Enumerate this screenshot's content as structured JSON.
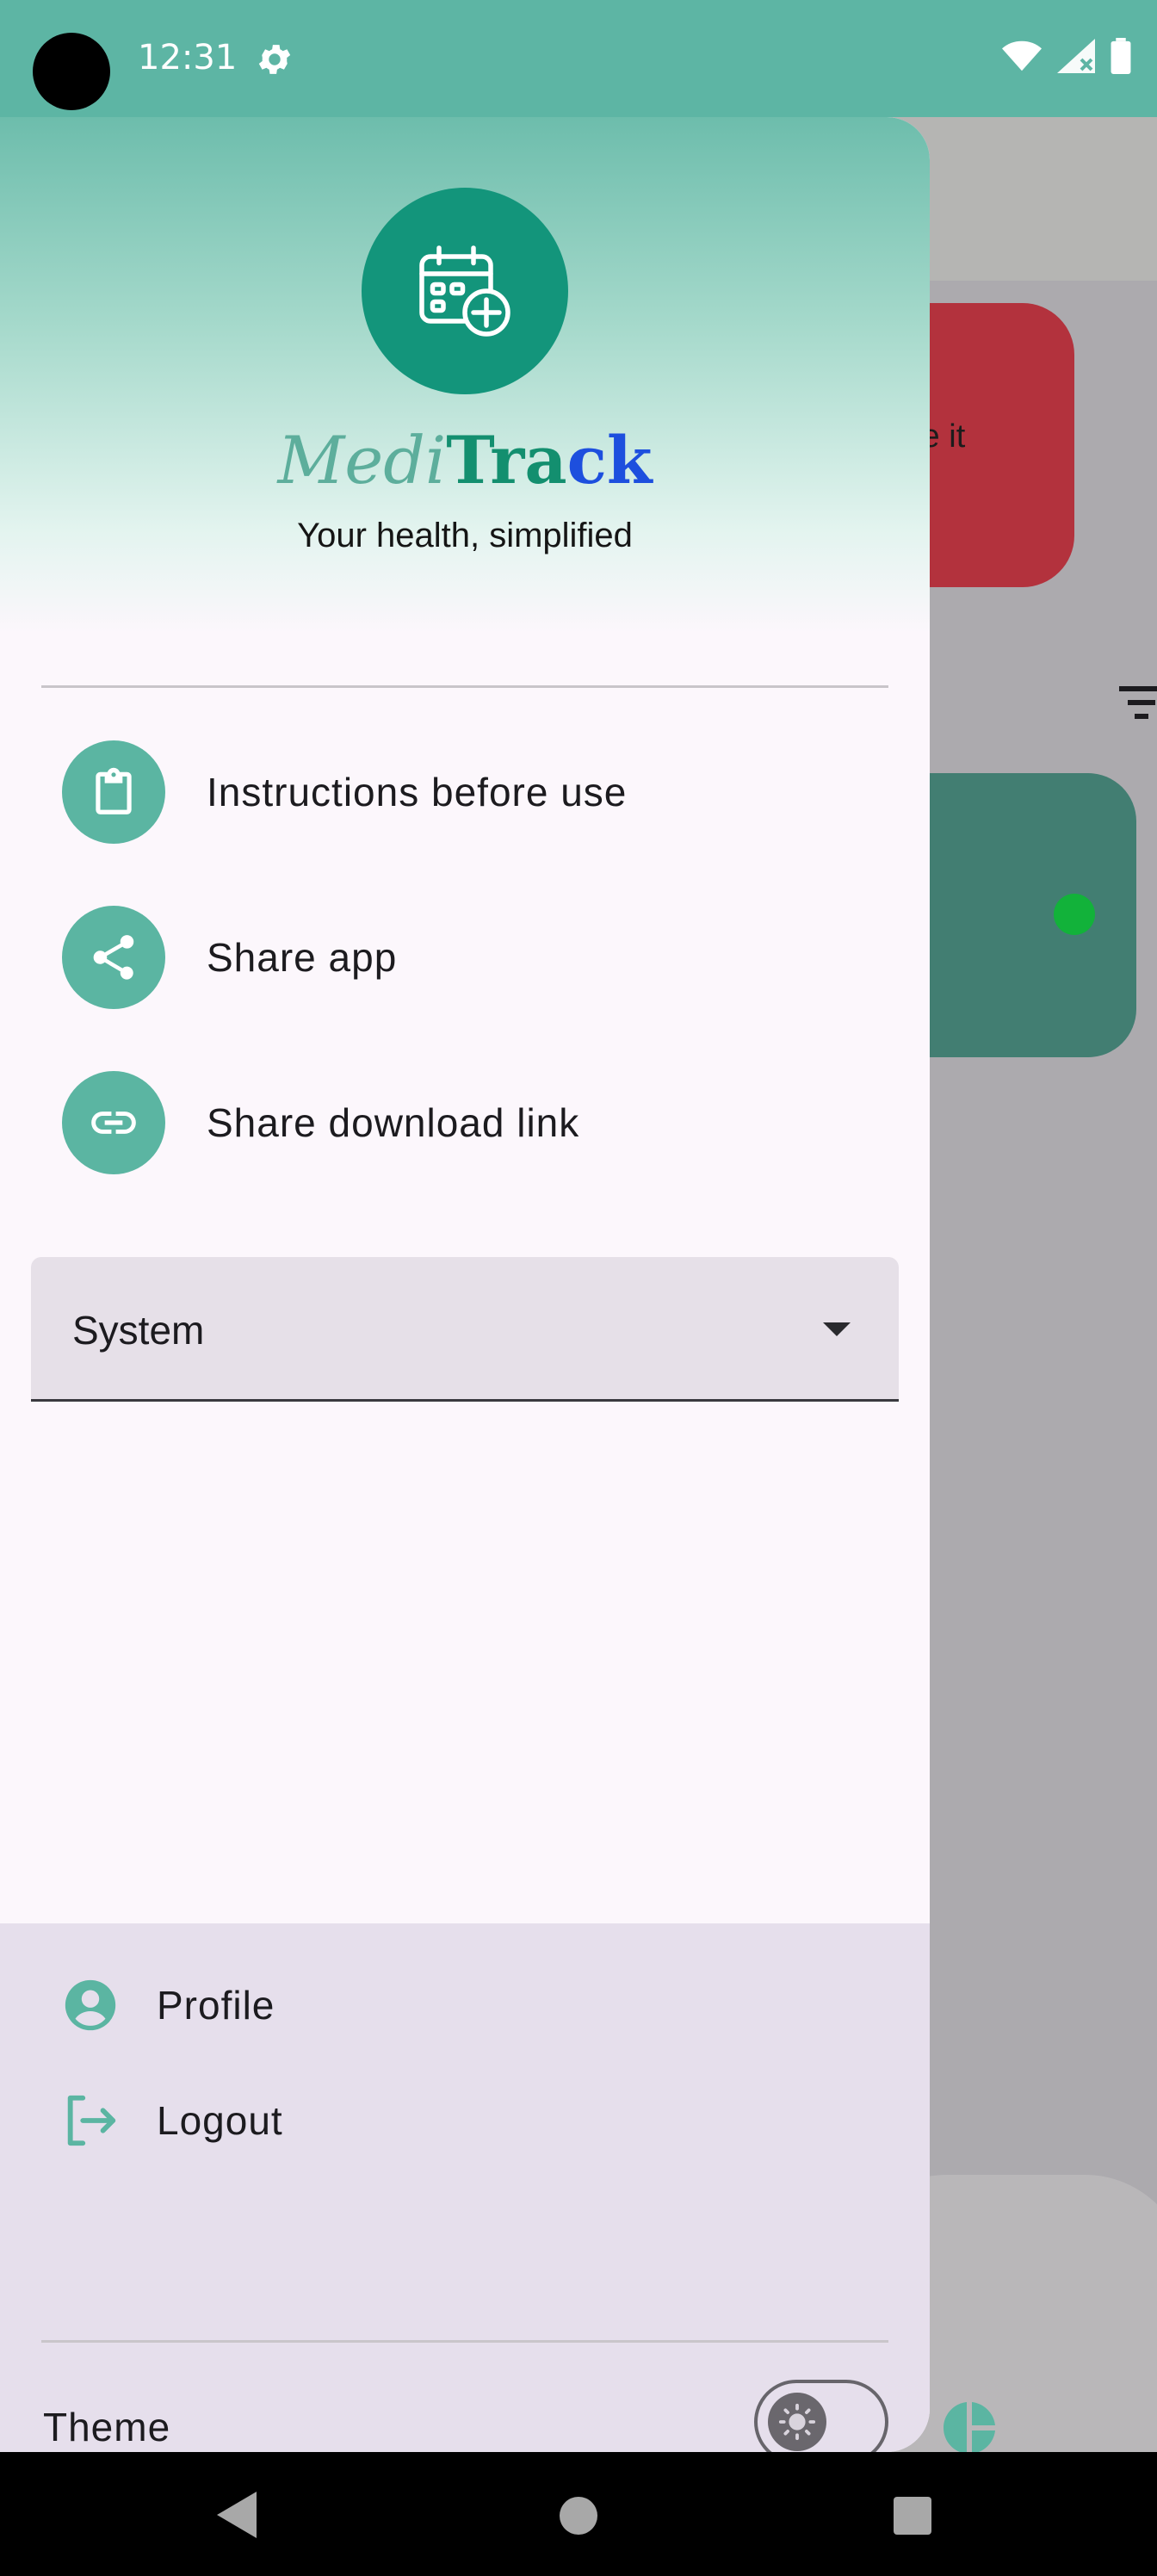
{
  "status_bar": {
    "time": "12:31"
  },
  "background": {
    "card_text": "te it"
  },
  "drawer": {
    "header": {
      "brand_medi": "Medi",
      "brand_tra": "Tra",
      "brand_ck": "ck",
      "tagline": "Your health, simplified"
    },
    "menu": [
      {
        "label": "Instructions before use",
        "icon": "clipboard-icon"
      },
      {
        "label": "Share app",
        "icon": "share-icon"
      },
      {
        "label": "Share download link",
        "icon": "link-icon"
      }
    ],
    "dropdown": {
      "value": "System"
    },
    "footer": {
      "profile_label": "Profile",
      "logout_label": "Logout",
      "theme_label": "Theme",
      "theme_toggle_on": false
    }
  },
  "colors": {
    "accent": "#5bb5a2",
    "brand_teal": "#13957b",
    "brand_blue": "#1d4fde",
    "status_bar": "#5db5a4"
  }
}
